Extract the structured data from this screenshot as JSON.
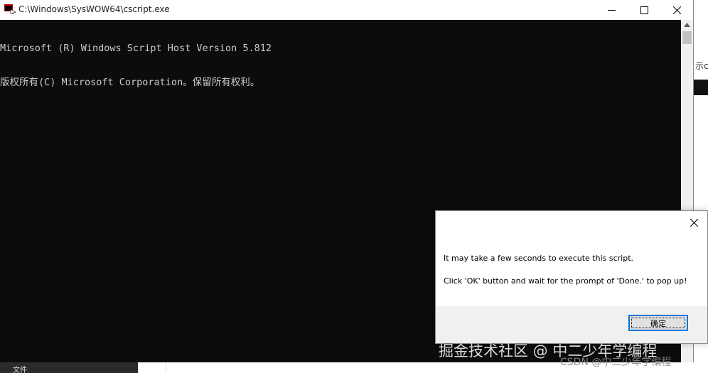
{
  "window": {
    "title": "C:\\Windows\\SysWOW64\\cscript.exe",
    "icon": "console-app-icon"
  },
  "console": {
    "lines": [
      "Microsoft (R) Windows Script Host Version 5.812",
      "版权所有(C) Microsoft Corporation。保留所有权利。"
    ]
  },
  "background_app": {
    "fragment": "示c"
  },
  "dialog": {
    "message_line1": "It may take a few seconds to execute this script.",
    "message_line2": "Click 'OK' button and wait for the prompt of 'Done.' to pop up!",
    "ok_label": "确定"
  },
  "taskbar": {
    "item_fragment": "文件"
  },
  "watermarks": {
    "primary": "掘金技术社区 @ 中二少年学编程",
    "secondary": "CSDN @中二少年学编程"
  },
  "colors": {
    "console_bg": "#0c0c0c",
    "console_text": "#cccccc",
    "focus_accent": "#0078d7"
  }
}
